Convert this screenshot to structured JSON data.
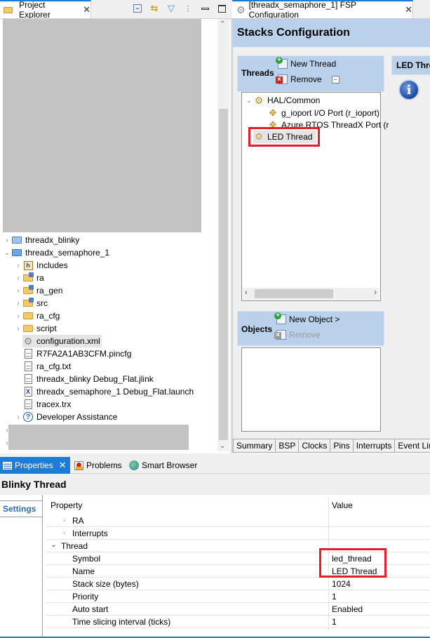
{
  "project_explorer": {
    "tab_label": "Project Explorer",
    "toolbar": [
      "collapse-all-icon",
      "link-with-editor-icon",
      "filter-icon",
      "view-menu-icon",
      "minimize-icon",
      "maximize-icon"
    ],
    "tree": [
      {
        "label": "threadx_blinky",
        "icon": "closed-project-icon",
        "expander": "collapsed",
        "level": 0
      },
      {
        "label": "threadx_semaphore_1",
        "icon": "project-icon",
        "expander": "expanded",
        "level": 0
      },
      {
        "label": "Includes",
        "icon": "includes-icon",
        "expander": "collapsed",
        "level": 1
      },
      {
        "label": "ra",
        "icon": "source-folder-icon",
        "expander": "collapsed",
        "level": 1
      },
      {
        "label": "ra_gen",
        "icon": "source-folder-icon",
        "expander": "collapsed",
        "level": 1
      },
      {
        "label": "src",
        "icon": "source-folder-icon",
        "expander": "collapsed",
        "level": 1
      },
      {
        "label": "ra_cfg",
        "icon": "folder-icon",
        "expander": "collapsed",
        "level": 1
      },
      {
        "label": "script",
        "icon": "folder-icon",
        "expander": "collapsed",
        "level": 1
      },
      {
        "label": "configuration.xml",
        "icon": "configuration-file-icon",
        "expander": "none",
        "level": 1,
        "selected": true
      },
      {
        "label": "R7FA2A1AB3CFM.pincfg",
        "icon": "text-file-icon",
        "expander": "none",
        "level": 1
      },
      {
        "label": "ra_cfg.txt",
        "icon": "text-file-icon",
        "expander": "none",
        "level": 1
      },
      {
        "label": "threadx_blinky Debug_Flat.jlink",
        "icon": "text-file-icon",
        "expander": "none",
        "level": 1
      },
      {
        "label": "threadx_semaphore_1 Debug_Flat.launch",
        "icon": "launch-file-icon",
        "expander": "none",
        "level": 1
      },
      {
        "label": "tracex.trx",
        "icon": "text-file-icon",
        "expander": "none",
        "level": 1
      },
      {
        "label": "Developer Assistance",
        "icon": "help-icon",
        "expander": "collapsed",
        "level": 1
      }
    ]
  },
  "fsp": {
    "tab_label": "[threadx_semaphore_1] FSP Configuration",
    "header": "Stacks Configuration",
    "threads_section": {
      "title": "Threads",
      "new_label": "New Thread",
      "remove_label": "Remove",
      "items": [
        {
          "label": "HAL/Common",
          "level": 0,
          "expander": "expanded",
          "icon": "hal-common-icon"
        },
        {
          "label": "g_ioport I/O Port (r_ioport)",
          "level": 1,
          "icon": "module-icon"
        },
        {
          "label": "Azure RTOS ThreadX Port (r",
          "level": 1,
          "icon": "module-icon"
        },
        {
          "label": "LED Thread",
          "level": 0,
          "icon": "thread-gear-icon",
          "selected": true,
          "highlighted": true
        }
      ]
    },
    "stacks_panel_title": "LED Thre",
    "objects_section": {
      "title": "Objects",
      "new_label": "New Object >",
      "remove_label": "Remove",
      "remove_enabled": false
    },
    "bottom_tabs": [
      "Summary",
      "BSP",
      "Clocks",
      "Pins",
      "Interrupts",
      "Event Links"
    ]
  },
  "properties": {
    "tabs": [
      {
        "label": "Properties",
        "active": true
      },
      {
        "label": "Problems",
        "active": false
      },
      {
        "label": "Smart Browser",
        "active": false
      }
    ],
    "title": "Blinky Thread",
    "side_tab": "Settings",
    "columns": [
      "Property",
      "Value"
    ],
    "rows": [
      {
        "property": "RA",
        "value": "",
        "level": 1,
        "expander": "collapsed"
      },
      {
        "property": "Interrupts",
        "value": "",
        "level": 1,
        "expander": "collapsed"
      },
      {
        "property": "Thread",
        "value": "",
        "level": 0,
        "expander": "expanded"
      },
      {
        "property": "Symbol",
        "value": "led_thread",
        "level": 2,
        "highlighted": true
      },
      {
        "property": "Name",
        "value": "LED Thread",
        "level": 2,
        "highlighted": true
      },
      {
        "property": "Stack size (bytes)",
        "value": "1024",
        "level": 2
      },
      {
        "property": "Priority",
        "value": "1",
        "level": 2
      },
      {
        "property": "Auto start",
        "value": "Enabled",
        "level": 2
      },
      {
        "property": "Time slicing interval (ticks)",
        "value": "1",
        "level": 2
      }
    ]
  },
  "colors": {
    "accent_blue": "#1f7bd8",
    "section_header_blue": "#b9d1ea",
    "highlight_red": "#e3202a",
    "redacted_gray": "#c3c3c3"
  }
}
